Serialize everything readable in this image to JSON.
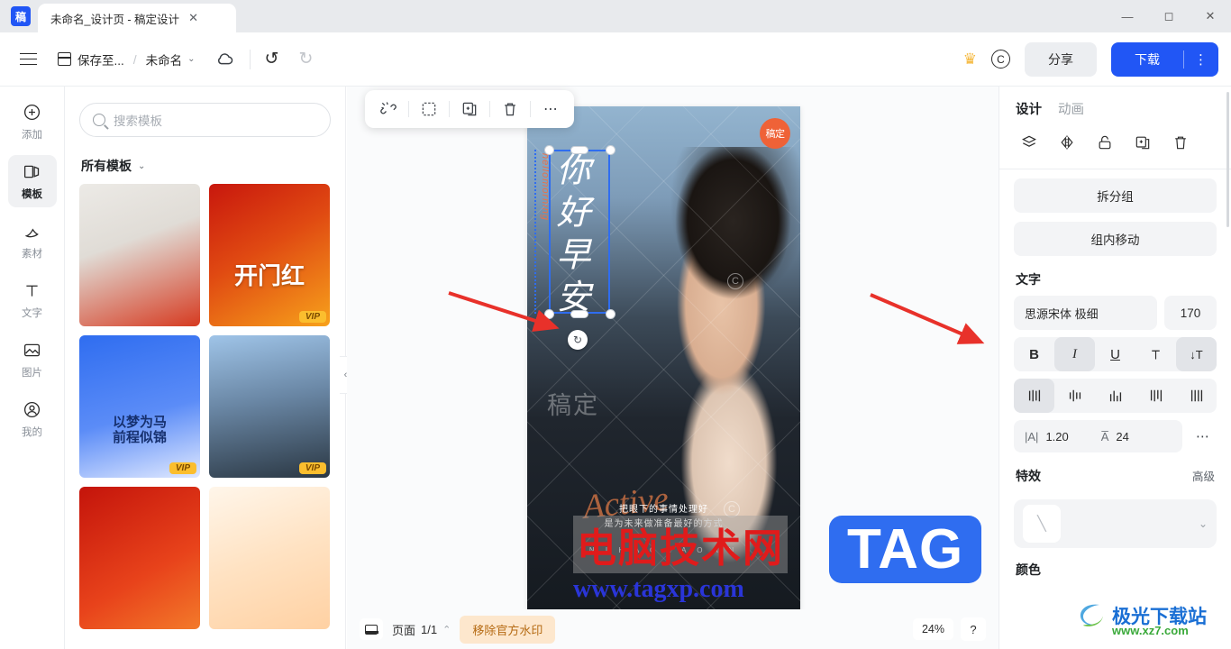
{
  "window": {
    "tab_title": "未命名_设计页 - 稿定设计",
    "tab_close": "✕",
    "logo_text": "稿",
    "minimize": "—",
    "maximize": "◻",
    "close": "✕"
  },
  "header": {
    "menu_icon": "hamburger-icon",
    "save_to_label": "保存至...",
    "separator": "/",
    "doc_name": "未命名",
    "doc_chevron": "⌄",
    "cloud_icon": "cloud-sync-icon",
    "undo_icon": "↺",
    "redo_icon": "↻",
    "crown_icon": "♛",
    "copyright_icon": "C",
    "share_label": "分享",
    "download_label": "下载",
    "download_more": "⋮"
  },
  "sidebar": {
    "items": [
      {
        "label": "添加",
        "icon": "plus-circle-icon",
        "active": false
      },
      {
        "label": "模板",
        "icon": "template-icon",
        "active": true
      },
      {
        "label": "素材",
        "icon": "material-icon",
        "active": false
      },
      {
        "label": "文字",
        "icon": "text-icon",
        "active": false
      },
      {
        "label": "图片",
        "icon": "image-icon",
        "active": false
      },
      {
        "label": "我的",
        "icon": "user-icon",
        "active": false
      }
    ]
  },
  "template_panel": {
    "search_placeholder": "搜索模板",
    "search_icon": "search-icon",
    "category_label": "所有模板",
    "category_chevron": "⌄",
    "vip_badge": "VIP",
    "thumbnails": [
      {
        "id": "t1",
        "caption": "",
        "vip": false
      },
      {
        "id": "t2",
        "caption": "开门红",
        "vip": true
      },
      {
        "id": "t3",
        "caption": "以梦为马\n前程似锦",
        "vip": true
      },
      {
        "id": "t4",
        "caption": "",
        "vip": true
      },
      {
        "id": "t5",
        "caption": "",
        "vip": false
      },
      {
        "id": "t6",
        "caption": "",
        "vip": false
      }
    ],
    "collapse_icon": "‹"
  },
  "canvas": {
    "float_toolbar": [
      {
        "name": "unlink-icon",
        "glyph": "⚯"
      },
      {
        "name": "move-select-icon",
        "glyph": "⤧"
      },
      {
        "name": "duplicate-icon",
        "glyph": "⧉"
      },
      {
        "name": "delete-icon",
        "glyph": "🗑"
      },
      {
        "name": "more-icon",
        "glyph": "⋯"
      }
    ],
    "badge_text": "稿定",
    "watermark_text": "稿定",
    "vertical_text": "你好早安",
    "vertical_text_en": "hellomorning",
    "signature": "Active",
    "subtitle_line1": "把眼下的事情处理好",
    "subtitle_line2": "是为未来做准备最好的方式",
    "subtitle_en": "N I H A O   Z A O A N",
    "rotate_icon": "↻",
    "copyright_mark": "C"
  },
  "bottombar": {
    "page_view_icon": "page-view-icon",
    "page_label": "页面",
    "page_indicator": "1/1",
    "page_chevron": "⌃",
    "remove_watermark_label": "移除官方水印",
    "zoom_level": "24%",
    "help_label": "?"
  },
  "right_panel": {
    "tabs": [
      {
        "label": "设计",
        "active": true
      },
      {
        "label": "动画",
        "active": false
      }
    ],
    "tool_icons": [
      {
        "name": "layers-icon",
        "glyph": "◇"
      },
      {
        "name": "flip-icon",
        "glyph": "⊲⊳"
      },
      {
        "name": "lock-icon",
        "glyph": "🔓"
      },
      {
        "name": "copy-icon",
        "glyph": "⧉"
      },
      {
        "name": "delete-icon",
        "glyph": "🗑"
      }
    ],
    "ungroup_label": "拆分组",
    "move_in_group_label": "组内移动",
    "text_section_title": "文字",
    "font_name": "思源宋体 极细",
    "font_size": "170",
    "style_buttons": [
      {
        "name": "bold",
        "glyph": "B",
        "active": false
      },
      {
        "name": "italic",
        "glyph": "I",
        "active": true
      },
      {
        "name": "underline",
        "glyph": "U",
        "active": false
      },
      {
        "name": "strikethrough",
        "glyph": "T̶",
        "active": false
      },
      {
        "name": "vertical-text",
        "glyph": "↓T",
        "active": true
      }
    ],
    "align_buttons": [
      {
        "name": "align-justify",
        "glyph": "|||",
        "active": true
      },
      {
        "name": "align-center",
        "glyph": "|||",
        "active": false
      },
      {
        "name": "align-bottom",
        "glyph": "|||",
        "active": false
      },
      {
        "name": "align-top",
        "glyph": "|||",
        "active": false
      },
      {
        "name": "align-distribute",
        "glyph": "||||",
        "active": false
      }
    ],
    "line_height_icon": "|A|",
    "line_height_value": "1.20",
    "letter_spacing_icon": "A̅",
    "letter_spacing_value": "24",
    "more_icon": "⋯",
    "effects_title": "特效",
    "effects_advanced": "高级",
    "effects_swatch": "╲",
    "effects_chevron": "⌄",
    "color_title": "颜色"
  },
  "watermarks": {
    "red_text": "电脑技术网",
    "url_text": "www.tagxp.com",
    "tag_text": "TAG",
    "jg_text": "极光下载站",
    "jg_url": "www.xz7.com"
  },
  "colors": {
    "accent_blue": "#2156f5",
    "orange_badge": "#ef6237",
    "vip_yellow": "#fbbe2e",
    "watermark_btn": "#fde7cd",
    "annotation_red": "#e8312a"
  }
}
